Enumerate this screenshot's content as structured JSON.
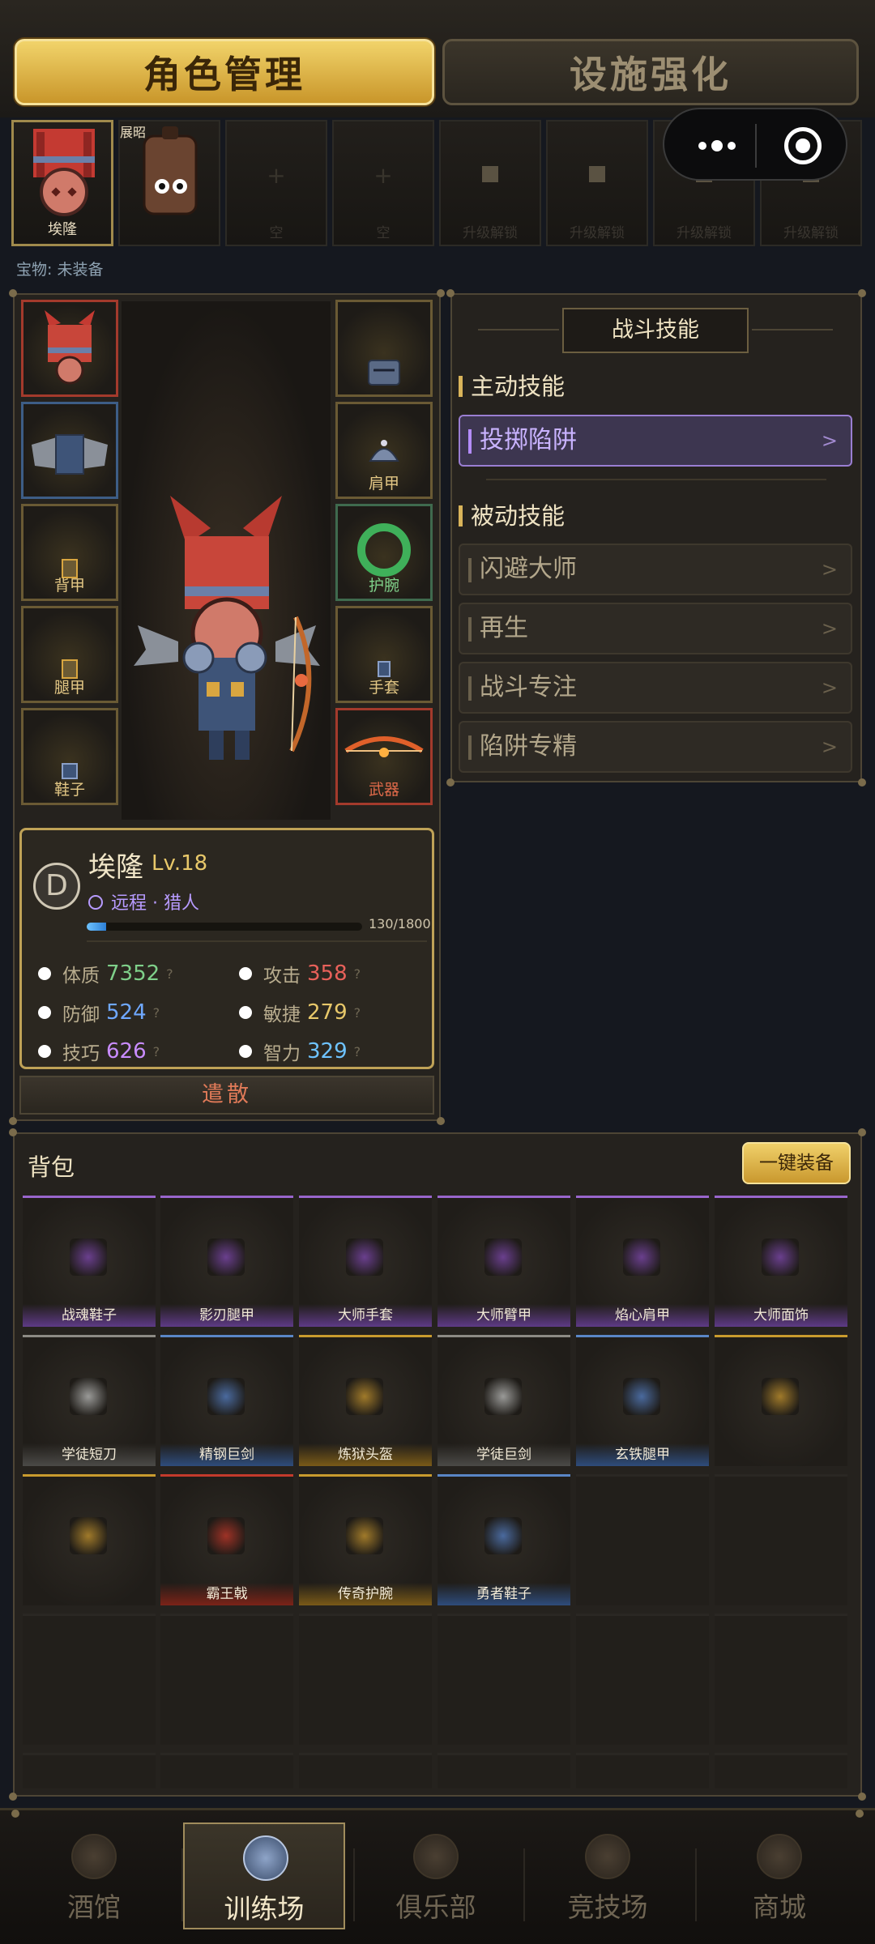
{
  "top_tabs": {
    "active": "角色管理",
    "inactive": "设施强化"
  },
  "roster": {
    "hero_1": "埃隆",
    "hero_2": "展昭",
    "slot_empty_a": "空",
    "slot_empty_b": "空",
    "slot_upgrade": "升级解锁"
  },
  "treasure": "宝物: 未装备",
  "equipment": {
    "left": [
      "",
      "",
      "背甲",
      "腿甲",
      "鞋子"
    ],
    "right": [
      "",
      "肩甲",
      "护腕",
      "手套",
      "武器"
    ]
  },
  "character": {
    "badge": "D",
    "name": "埃隆",
    "level": "Lv.18",
    "class": "远程 · 猎人",
    "xp_text": "130/1800",
    "xp_fraction": 0.072,
    "stats": {
      "constitution_label": "体质",
      "constitution": "7352",
      "attack_label": "攻击",
      "attack": "358",
      "defense_label": "防御",
      "defense": "524",
      "agility_label": "敏捷",
      "agility": "279",
      "skill_label": "技巧",
      "skill": "626",
      "intellect_label": "智力",
      "intellect": "329",
      "help": "?"
    },
    "dismiss": "遣散"
  },
  "skills": {
    "title": "战斗技能",
    "active_header": "主动技能",
    "active": [
      "投掷陷阱"
    ],
    "passive_header": "被动技能",
    "passive": [
      "闪避大师",
      "再生",
      "战斗专注",
      "陷阱专精"
    ],
    "arrow": ">"
  },
  "backpack": {
    "title": "背包",
    "equip_all": "一键装备",
    "items": [
      {
        "name": "战魂鞋子",
        "quality": "purple"
      },
      {
        "name": "影刃腿甲",
        "quality": "purple"
      },
      {
        "name": "大师手套",
        "quality": "purple"
      },
      {
        "name": "大师臂甲",
        "quality": "purple"
      },
      {
        "name": "焰心肩甲",
        "quality": "purple"
      },
      {
        "name": "大师面饰",
        "quality": "purple"
      },
      {
        "name": "学徒短刀",
        "quality": "white"
      },
      {
        "name": "精钢巨剑",
        "quality": "blue"
      },
      {
        "name": "炼狱头盔",
        "quality": "gold"
      },
      {
        "name": "学徒巨剑",
        "quality": "white"
      },
      {
        "name": "玄铁腿甲",
        "quality": "blue"
      },
      {
        "name": "",
        "quality": "gold"
      },
      {
        "name": "",
        "quality": "gold"
      },
      {
        "name": "霸王戟",
        "quality": "red"
      },
      {
        "name": "传奇护腕",
        "quality": "gold"
      },
      {
        "name": "勇者鞋子",
        "quality": "blue"
      }
    ]
  },
  "bottom_nav": [
    "酒馆",
    "训练场",
    "俱乐部",
    "竞技场",
    "商城"
  ],
  "bottom_nav_active": "训练场",
  "colors": {
    "gold_accent": "#d9b45a",
    "purple_quality": "#9966cc",
    "blue_quality": "#5a86c6",
    "red_quality": "#c33a2c",
    "gold_quality": "#c99b2e",
    "stat_green": "#7fd08a",
    "stat_red": "#e8615a",
    "stat_blue": "#6fa8ff",
    "stat_yellow": "#e8c86a",
    "stat_purple": "#c98cff",
    "stat_cyan": "#6ec3ff"
  }
}
